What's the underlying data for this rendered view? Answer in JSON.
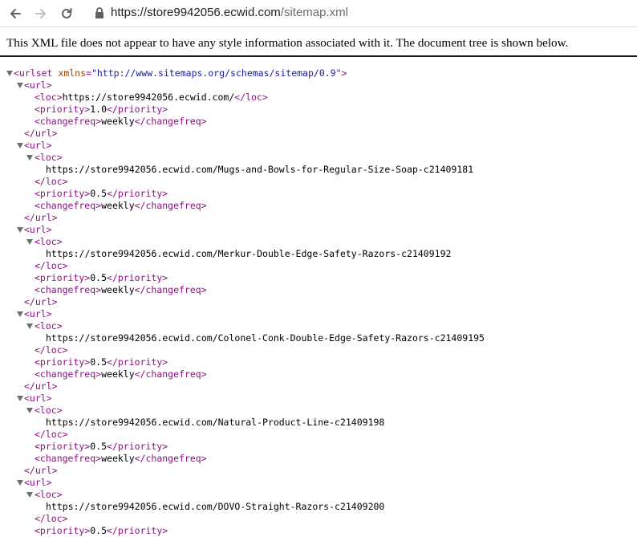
{
  "browser": {
    "url_host": "https://store9942056.ecwid.com",
    "url_path": "/sitemap.xml"
  },
  "xml_viewer": {
    "info_message": "This XML file does not appear to have any style information associated with it. The document tree is shown below.",
    "root": {
      "open": "<urlset",
      "attr_name": "xmlns",
      "attr_value": "\"http://www.sitemaps.org/schemas/sitemap/0.9\"",
      "close": ">"
    },
    "tags": {
      "url_open": "<url>",
      "url_close": "</url>",
      "loc_open": "<loc>",
      "loc_close": "</loc>",
      "priority_open": "<priority>",
      "priority_close": "</priority>",
      "changefreq_open": "<changefreq>",
      "changefreq_close": "</changefreq>"
    },
    "urls": [
      {
        "loc": "https://store9942056.ecwid.com/",
        "priority": "1.0",
        "changefreq": "weekly"
      },
      {
        "loc": "https://store9942056.ecwid.com/Mugs-and-Bowls-for-Regular-Size-Soap-c21409181",
        "priority": "0.5",
        "changefreq": "weekly"
      },
      {
        "loc": "https://store9942056.ecwid.com/Merkur-Double-Edge-Safety-Razors-c21409192",
        "priority": "0.5",
        "changefreq": "weekly"
      },
      {
        "loc": "https://store9942056.ecwid.com/Colonel-Conk-Double-Edge-Safety-Razors-c21409195",
        "priority": "0.5",
        "changefreq": "weekly"
      },
      {
        "loc": "https://store9942056.ecwid.com/Natural-Product-Line-c21409198",
        "priority": "0.5",
        "changefreq": "weekly"
      },
      {
        "loc": "https://store9942056.ecwid.com/DOVO-Straight-Razors-c21409200",
        "priority": "0.5",
        "changefreq": ""
      }
    ]
  }
}
